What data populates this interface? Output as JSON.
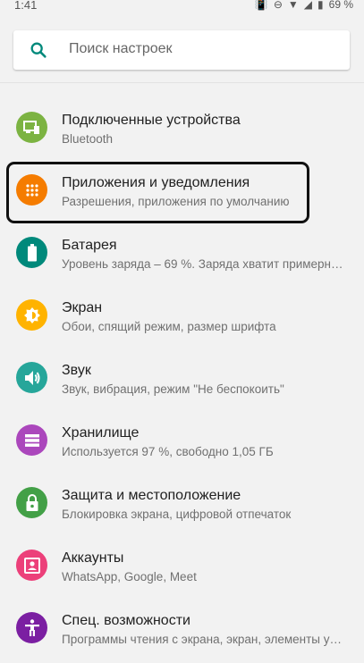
{
  "status_bar": {
    "time": "1:41",
    "battery": "69 %"
  },
  "search": {
    "placeholder": "Поиск настроек"
  },
  "items": [
    {
      "title": "Подключенные устройства",
      "subtitle": "Bluetooth",
      "color": "#7cb342",
      "icon": "devices-icon"
    },
    {
      "title": "Приложения и уведомления",
      "subtitle": "Разрешения, приложения по умолчанию",
      "color": "#f57c00",
      "icon": "apps-grid-icon"
    },
    {
      "title": "Батарея",
      "subtitle": "Уровень заряда – 69 %. Заряда хватит примерн…",
      "color": "#00897b",
      "icon": "battery-icon"
    },
    {
      "title": "Экран",
      "subtitle": "Обои, спящий режим, размер шрифта",
      "color": "#ffb300",
      "icon": "brightness-icon"
    },
    {
      "title": "Звук",
      "subtitle": "Звук, вибрация, режим \"Не беспокоить\"",
      "color": "#26a69a",
      "icon": "volume-icon"
    },
    {
      "title": "Хранилище",
      "subtitle": "Используется 97 %, свободно 1,05 ГБ",
      "color": "#ab47bc",
      "icon": "storage-icon"
    },
    {
      "title": "Защита и местоположение",
      "subtitle": "Блокировка экрана, цифровой отпечаток",
      "color": "#43a047",
      "icon": "lock-icon"
    },
    {
      "title": "Аккаунты",
      "subtitle": "WhatsApp, Google, Meet",
      "color": "#ec407a",
      "icon": "account-icon"
    },
    {
      "title": "Спец. возможности",
      "subtitle": "Программы чтения с экрана, экран, элементы у…",
      "color": "#7b1fa2",
      "icon": "accessibility-icon"
    }
  ]
}
